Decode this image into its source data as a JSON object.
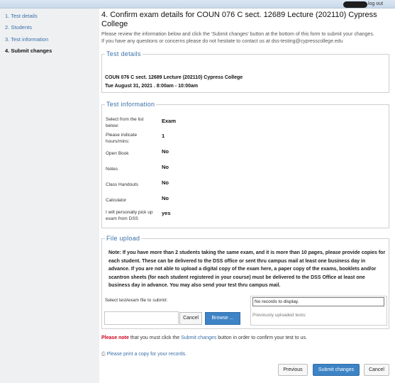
{
  "header": {
    "logout_label": "log out"
  },
  "sidebar": {
    "items": [
      {
        "label": "1. Test details"
      },
      {
        "label": "2. Students"
      },
      {
        "label": "3. Test information"
      },
      {
        "label": "4. Submit changes"
      }
    ]
  },
  "main": {
    "title": "4. Confirm exam details for COUN 076 C sect. 12689 Lecture (202110) Cypress College",
    "intro_line1": "Please review the information below and click the 'Submit changes' button at the bottom of this form to submit your changes.",
    "intro_line2": "If you have any questions or concerns please do not hesitate to contact us at dss-testing@cypresscollege.edu"
  },
  "test_details": {
    "legend": "Test details",
    "course_line": "COUN 076 C sect. 12689 Lecture (202110) Cypress College",
    "date_line": "Tue August 31, 2021 . 8:00am - 10:00am"
  },
  "test_information": {
    "legend": "Test information",
    "rows": [
      {
        "label": "Select from the list below:",
        "value": "Exam"
      },
      {
        "label": "Please indicate hours/mins:",
        "value": "1"
      },
      {
        "label": "Open Book",
        "value": "No"
      },
      {
        "label": "Notes",
        "value": "No"
      },
      {
        "label": "Class Handouts",
        "value": "No"
      },
      {
        "label": "Calculator",
        "value": "No"
      },
      {
        "label": "I will personally pick up exam from DSS",
        "value": "yes"
      }
    ]
  },
  "file_upload": {
    "legend": "File upload",
    "note": "Note: If you have more than 2 students taking the same exam, and it is more than 10 pages, please provide copies for each student. These can be delivered to the DSS office or sent thru campus mail at least one business day in advance. If you are not able to upload a digital copy of the exam here, a paper copy of the exams, booklets and/or scantron sheets (for each student registered in your course) must be delivered to the DSS Office at least one business day in advance. You may also send your test thru campus mail.",
    "select_label": "Select test/exam file to submit:",
    "cancel_label": "Cancel",
    "browse_label": "Browse ...",
    "no_records": "No records to display.",
    "previously_uploaded": "Previously uploaded tests:"
  },
  "footer": {
    "please_note_red": "Please note",
    "please_note_mid": " that you must click the ",
    "please_note_link": "Submit changes",
    "please_note_end": " button in order to confirm your test to us.",
    "print_label": "Please print a copy for your records.",
    "previous_label": "Previous",
    "submit_label": "Submit changes",
    "cancel_label": "Cancel"
  },
  "colors": {
    "link": "#3a70a8",
    "primary_button": "#3d83c5",
    "warning_red": "#d0021b",
    "sidebar_bg": "#eef0f2"
  }
}
